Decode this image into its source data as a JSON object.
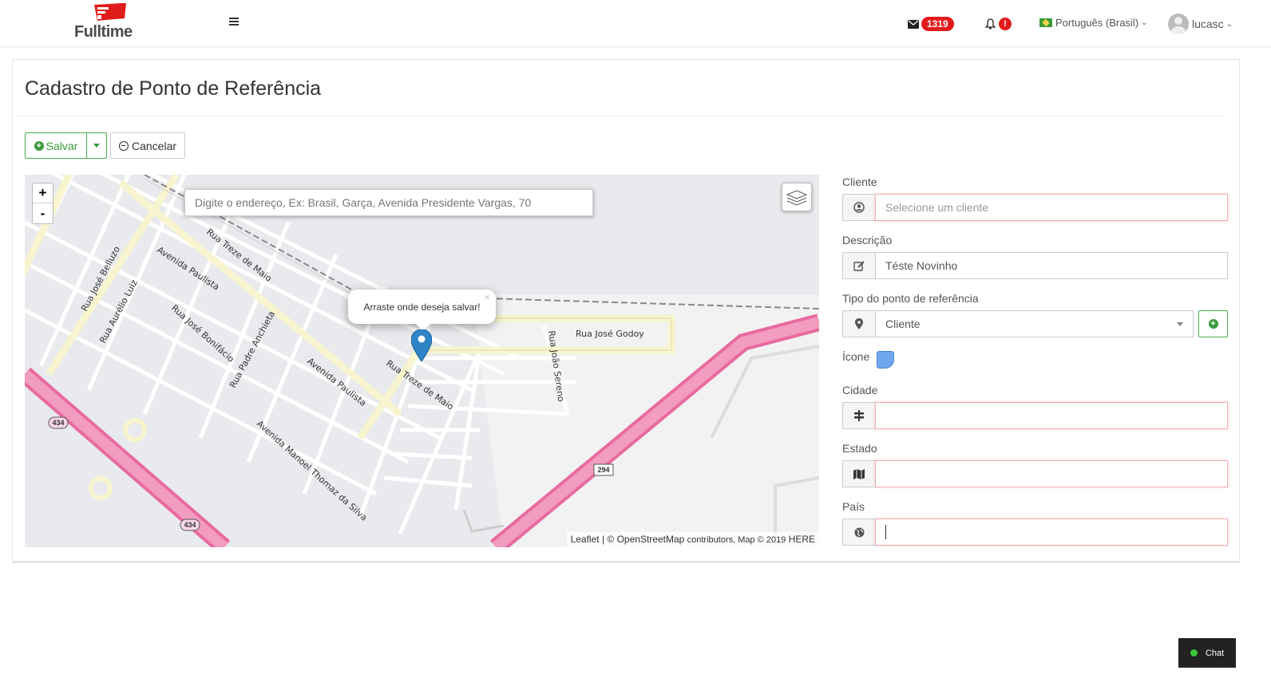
{
  "brand": {
    "name": "Fulltime",
    "accent": "#e01b1b"
  },
  "header": {
    "messages_count": "1319",
    "alerts_badge": "!",
    "language": "Português (Brasil)",
    "user": "lucasc"
  },
  "page": {
    "title": "Cadastro de Ponto de Referência"
  },
  "toolbar": {
    "save_label": "Salvar",
    "cancel_label": "Cancelar"
  },
  "map": {
    "search_placeholder": "Digite o endereço, Ex: Brasil, Garça, Avenida Presidente Vargas, 70",
    "popup_text": "Arraste onde deseja salvar!",
    "zoom_in": "+",
    "zoom_out": "-",
    "attribution": {
      "leaflet": "Leaflet",
      "osm": "© OpenStreetMap",
      "rest": "contributors, Map © 2019",
      "here": "HERE"
    },
    "street_labels": [
      "Avenida Paulista",
      "Rua Treze de Maio",
      "Rua José Bonifácio",
      "Rua Padre Anchieta",
      "Rua José Belluzo",
      "Rua Aurélio Luiz",
      "Avenida Manoel Thomaz da Silva",
      "Rua José Godoy",
      "Rua João Sereno",
      "Rua Treze de Maio",
      "Avenida Paulista",
      "434",
      "434",
      "294"
    ]
  },
  "form": {
    "cliente": {
      "label": "Cliente",
      "placeholder": "Selecione um cliente",
      "icon": "user-circle-icon"
    },
    "descricao": {
      "label": "Descrição",
      "value": "Téste Novinho",
      "icon": "edit-icon"
    },
    "tipo": {
      "label": "Tipo do ponto de referência",
      "value": "Cliente",
      "icon": "map-marker-icon"
    },
    "icone": {
      "label": "Ícone",
      "color": "#6fa6ee"
    },
    "cidade": {
      "label": "Cidade",
      "value": "",
      "icon": "signpost-icon"
    },
    "estado": {
      "label": "Estado",
      "value": "",
      "icon": "map-icon"
    },
    "pais": {
      "label": "País",
      "value": "",
      "icon": "globe-icon"
    }
  },
  "chat": {
    "label": "Chat",
    "status_color": "#3cc53c"
  }
}
